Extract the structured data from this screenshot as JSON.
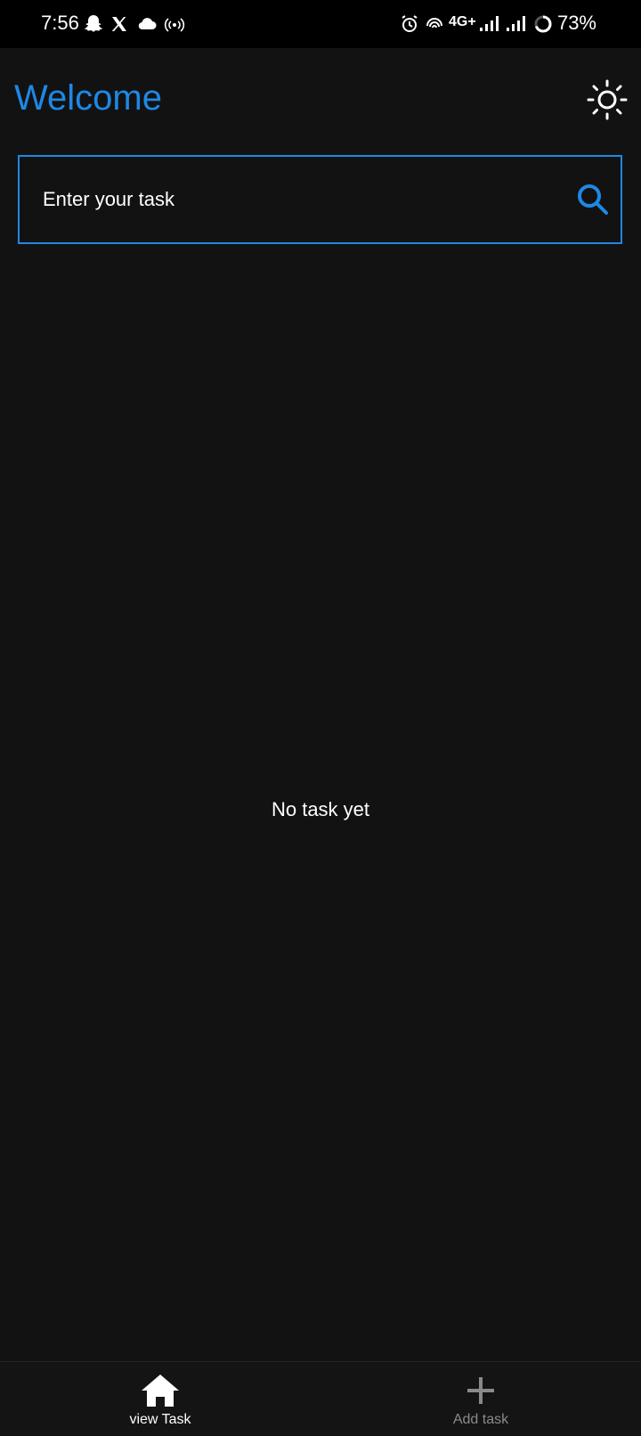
{
  "status_bar": {
    "time": "7:56",
    "network": "4G+",
    "battery": "73%",
    "left_icons": [
      "snapchat-icon",
      "x-icon",
      "cloud-icon",
      "hotspot-icon"
    ],
    "right_icons": [
      "alarm-icon",
      "wifi-calling-icon",
      "signal-icon",
      "signal-icon",
      "battery-ring-icon"
    ]
  },
  "header": {
    "title": "Welcome",
    "theme_icon": "sun-icon"
  },
  "search": {
    "placeholder": "Enter your task",
    "value": "",
    "icon": "search-icon"
  },
  "main": {
    "empty_message": "No task yet"
  },
  "bottom_nav": {
    "items": [
      {
        "label": "view Task",
        "icon": "home-icon",
        "active": true
      },
      {
        "label": "Add task",
        "icon": "plus-icon",
        "active": false
      }
    ]
  },
  "colors": {
    "accent": "#1e88e5",
    "background": "#121212",
    "status_bar": "#000000",
    "inactive": "#8a8a8a"
  }
}
